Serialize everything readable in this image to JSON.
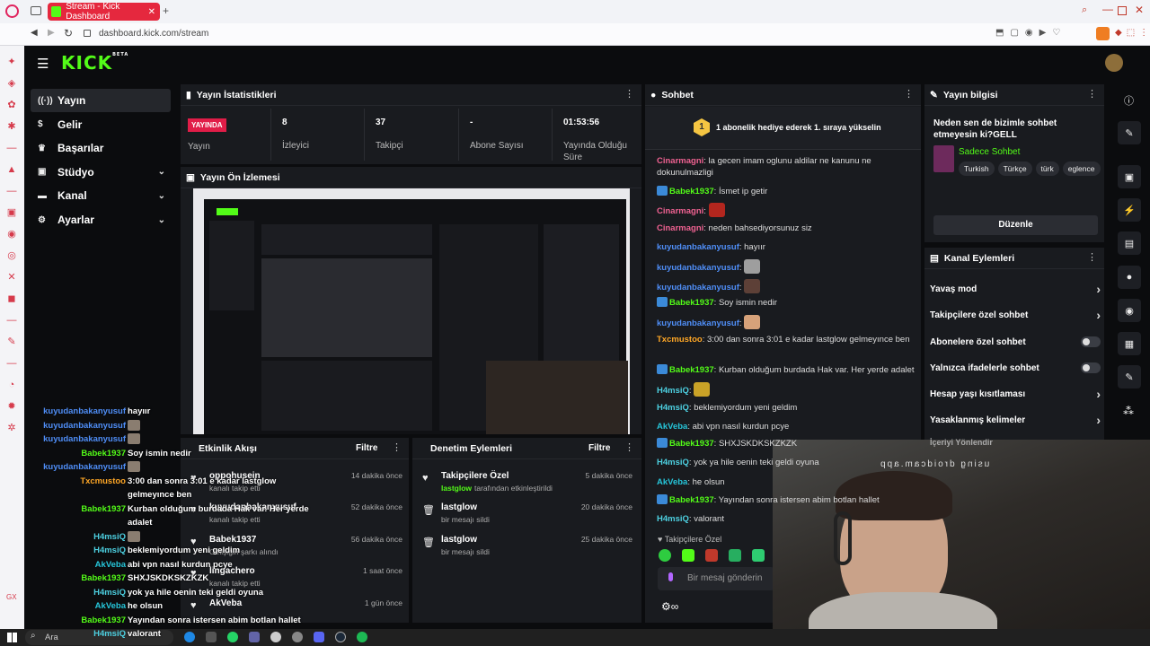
{
  "browser": {
    "tab_title": "Stream - Kick Dashboard",
    "url": "dashboard.kick.com/stream"
  },
  "logo": {
    "text": "KICK",
    "beta": "BETA"
  },
  "nav": [
    {
      "label": "Yayın",
      "icon": "broadcast-icon",
      "active": true,
      "expand": false
    },
    {
      "label": "Gelir",
      "icon": "dollar-icon",
      "active": false,
      "expand": false
    },
    {
      "label": "Başarılar",
      "icon": "trophy-icon",
      "active": false,
      "expand": false
    },
    {
      "label": "Stüdyo",
      "icon": "studio-icon",
      "active": false,
      "expand": true
    },
    {
      "label": "Kanal",
      "icon": "channel-icon",
      "active": false,
      "expand": true
    },
    {
      "label": "Ayarlar",
      "icon": "gear-icon",
      "active": false,
      "expand": true
    }
  ],
  "stats": {
    "title": "Yayın İstatistikleri",
    "live_badge": "YAYINDA",
    "live_label": "Yayın",
    "items": [
      {
        "value": "8",
        "label": "İzleyici"
      },
      {
        "value": "37",
        "label": "Takipçi"
      },
      {
        "value": "-",
        "label": "Abone Sayısı"
      },
      {
        "value": "01:53:56",
        "label": "Yayında Olduğu Süre"
      }
    ]
  },
  "preview": {
    "title": "Yayın Ön İzlemesi"
  },
  "activity": {
    "title": "Etkinlik Akışı",
    "filter": "Filtre",
    "items": [
      {
        "name": "oppohusein",
        "sub": "kanalı takip etti",
        "time": "14 dakika önce"
      },
      {
        "name": "kuyudanbakanyusuf",
        "sub": "kanalı takip etti",
        "time": "52 dakika önce"
      },
      {
        "name": "Babek1937",
        "sub": "Gelişigin şarkı alındı",
        "time": "56 dakika önce"
      },
      {
        "name": "lingachero",
        "sub": "kanalı takip etti",
        "time": "1 saat önce"
      },
      {
        "name": "AkVeba",
        "sub": "",
        "time": "1 gün önce"
      }
    ]
  },
  "moderation": {
    "title": "Denetim Eylemleri",
    "filter": "Filtre",
    "items": [
      {
        "title": "Takipçilere Özel",
        "user": "lastglow",
        "sub": "tarafından etkinleştirildi",
        "time": "5 dakika önce",
        "icon": "heart-icon"
      },
      {
        "title": "lastglow",
        "user": "",
        "sub": "bir mesajı sildi",
        "time": "20 dakika önce",
        "icon": "trash-icon"
      },
      {
        "title": "lastglow",
        "user": "",
        "sub": "bir mesajı sildi",
        "time": "25 dakika önce",
        "icon": "trash-icon"
      }
    ]
  },
  "chat": {
    "title": "Sohbet",
    "pinned": "1 abonelik hediye ederek 1. sıraya yükselin",
    "pinned_rank": "1",
    "mode_label": "Takipçilere Özel",
    "input_placeholder": "Bir mesaj gönderin",
    "messages": [
      {
        "user": "Cinarmagni",
        "color": "#f06292",
        "badge": false,
        "text": "la gecen imam oglunu aldilar ne kanunu ne dokunulmazligi"
      },
      {
        "user": "Babek1937",
        "color": "#53fc18",
        "badge": true,
        "text": "İsmet ip getir"
      },
      {
        "user": "Cinarmagni",
        "color": "#f06292",
        "badge": false,
        "text": "",
        "emote": "#b3261e"
      },
      {
        "user": "Cinarmagni",
        "color": "#f06292",
        "badge": false,
        "text": "neden bahsediyorsunuz siz"
      },
      {
        "user": "kuyudanbakanyusuf",
        "color": "#4f8ef7",
        "badge": false,
        "text": "hayıır"
      },
      {
        "user": "kuyudanbakanyusuf",
        "color": "#4f8ef7",
        "badge": false,
        "text": "",
        "emote": "#9e9e9e"
      },
      {
        "user": "kuyudanbakanyusuf",
        "color": "#4f8ef7",
        "badge": false,
        "text": "",
        "emote": "#5d4037"
      },
      {
        "user": "Babek1937",
        "color": "#53fc18",
        "badge": true,
        "text": "Soy ismin nedir"
      },
      {
        "user": "kuyudanbakanyusuf",
        "color": "#4f8ef7",
        "badge": false,
        "text": "",
        "emote": "#d7a27a"
      },
      {
        "user": "Txcmustoo",
        "color": "#ffa726",
        "badge": false,
        "text": "3:00 dan sonra 3:01 e kadar lastglow gelmeyınce ben"
      },
      {
        "user": "Babek1937",
        "color": "#53fc18",
        "badge": true,
        "text": "Kurban olduğum burdada Hak var. Her yerde adalet"
      },
      {
        "user": "H4msiQ",
        "color": "#4dd0e1",
        "badge": false,
        "text": "",
        "emote": "#c9a227"
      },
      {
        "user": "H4msiQ",
        "color": "#4dd0e1",
        "badge": false,
        "text": "beklemiyordum yeni geldim"
      },
      {
        "user": "AkVeba",
        "color": "#26c6da",
        "badge": false,
        "text": "abi vpn nasıl kurdun pcye"
      },
      {
        "user": "Babek1937",
        "color": "#53fc18",
        "badge": true,
        "text": "SHXJSKDKSKZKZK"
      },
      {
        "user": "H4msiQ",
        "color": "#4dd0e1",
        "badge": false,
        "text": "yok ya hile oenin teki geldi oyuna"
      },
      {
        "user": "AkVeba",
        "color": "#26c6da",
        "badge": false,
        "text": "he olsun"
      },
      {
        "user": "Babek1937",
        "color": "#53fc18",
        "badge": true,
        "text": "Yayından sonra istersen abim botlan hallet"
      },
      {
        "user": "H4msiQ",
        "color": "#4dd0e1",
        "badge": false,
        "text": "valorant"
      }
    ]
  },
  "streaminfo": {
    "title": "Yayın bilgisi",
    "stream_title": "Neden sen de bizimle sohbet etmeyesin ki?GELL",
    "category": "Sadece Sohbet",
    "tags": [
      "Turkish",
      "Türkçe",
      "türk",
      "eglence"
    ],
    "edit_button": "Düzenle"
  },
  "channel_actions": {
    "title": "Kanal Eylemleri",
    "items": [
      {
        "label": "Yavaş mod",
        "control": "chevron"
      },
      {
        "label": "Takipçilere özel sohbet",
        "control": "chevron"
      },
      {
        "label": "Abonelere özel sohbet",
        "control": "toggle"
      },
      {
        "label": "Yalnızca ifadelerle sohbet",
        "control": "toggle"
      },
      {
        "label": "Hesap yaşı kısıtlaması",
        "control": "chevron"
      },
      {
        "label": "Yasaklanmış kelimeler",
        "control": "chevron"
      },
      {
        "label": "İçeriyi Yönlendir",
        "control": ""
      }
    ]
  },
  "overlay_chat": [
    {
      "user": "kuyudanbakanyusuf",
      "color": "#4f8ef7",
      "text": "hayıır"
    },
    {
      "user": "kuyudanbakanyusuf",
      "color": "#4f8ef7",
      "text": ""
    },
    {
      "user": "kuyudanbakanyusuf",
      "color": "#4f8ef7",
      "text": ""
    },
    {
      "user": "Babek1937",
      "color": "#53fc18",
      "text": "Soy ismin nedir"
    },
    {
      "user": "kuyudanbakanyusuf",
      "color": "#4f8ef7",
      "text": ""
    },
    {
      "user": "Txcmustoo",
      "color": "#ffa726",
      "text": "3:00 dan sonra 3:01 e kadar lastglow"
    },
    {
      "user": "",
      "color": "#fff",
      "text": "gelmeyınce ben"
    },
    {
      "user": "Babek1937",
      "color": "#53fc18",
      "text": "Kurban olduğum burdada Hak var. Her yerde"
    },
    {
      "user": "",
      "color": "#fff",
      "text": "adalet"
    },
    {
      "user": "H4msiQ",
      "color": "#4dd0e1",
      "text": ""
    },
    {
      "user": "H4msiQ",
      "color": "#4dd0e1",
      "text": "beklemiyordum yeni geldim"
    },
    {
      "user": "AkVeba",
      "color": "#26c6da",
      "text": "abi vpn nasıl kurdun pcye"
    },
    {
      "user": "Babek1937",
      "color": "#53fc18",
      "text": "SHXJSKDKSKZKZK"
    },
    {
      "user": "H4msiQ",
      "color": "#4dd0e1",
      "text": "yok ya hile oenin teki geldi oyuna"
    },
    {
      "user": "AkVeba",
      "color": "#26c6da",
      "text": "he olsun"
    },
    {
      "user": "Babek1937",
      "color": "#53fc18",
      "text": "Yayından sonra istersen abim botlan hallet"
    },
    {
      "user": "H4msiQ",
      "color": "#4dd0e1",
      "text": "valorant"
    }
  ],
  "webcam": {
    "caption": "using droidcam.app"
  },
  "taskbar": {
    "search": "Ara"
  },
  "colors": {
    "brand": "#53fc18",
    "live": "#e11d48"
  }
}
